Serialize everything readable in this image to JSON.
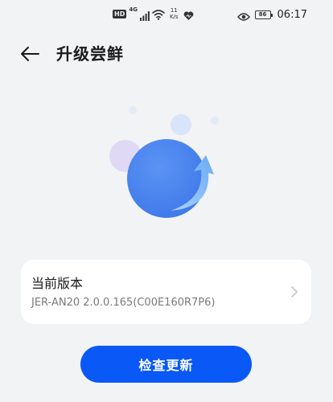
{
  "status_bar": {
    "hd_badge": "HD",
    "network_generation": "4G",
    "speed_value": "11",
    "speed_unit": "K/s",
    "battery_level": "86",
    "time": "06:17"
  },
  "header": {
    "back_icon": "arrow-left-icon",
    "title": "升级尝鲜"
  },
  "illustration": {
    "name": "update-illustration",
    "colors": {
      "main_circle": "#4a86f0",
      "arrow": "#8fc4fb",
      "purple_circle": "#dfd9f5",
      "small_blue_circle": "#d7e4f9"
    }
  },
  "version_card": {
    "label": "当前版本",
    "value": "JER-AN20 2.0.0.165(C00E160R7P6)",
    "chevron_icon": "chevron-right-icon"
  },
  "actions": {
    "check_update_label": "检查更新"
  },
  "colors": {
    "background": "#f1f3f5",
    "card": "#ffffff",
    "accent": "#0a59f7"
  }
}
